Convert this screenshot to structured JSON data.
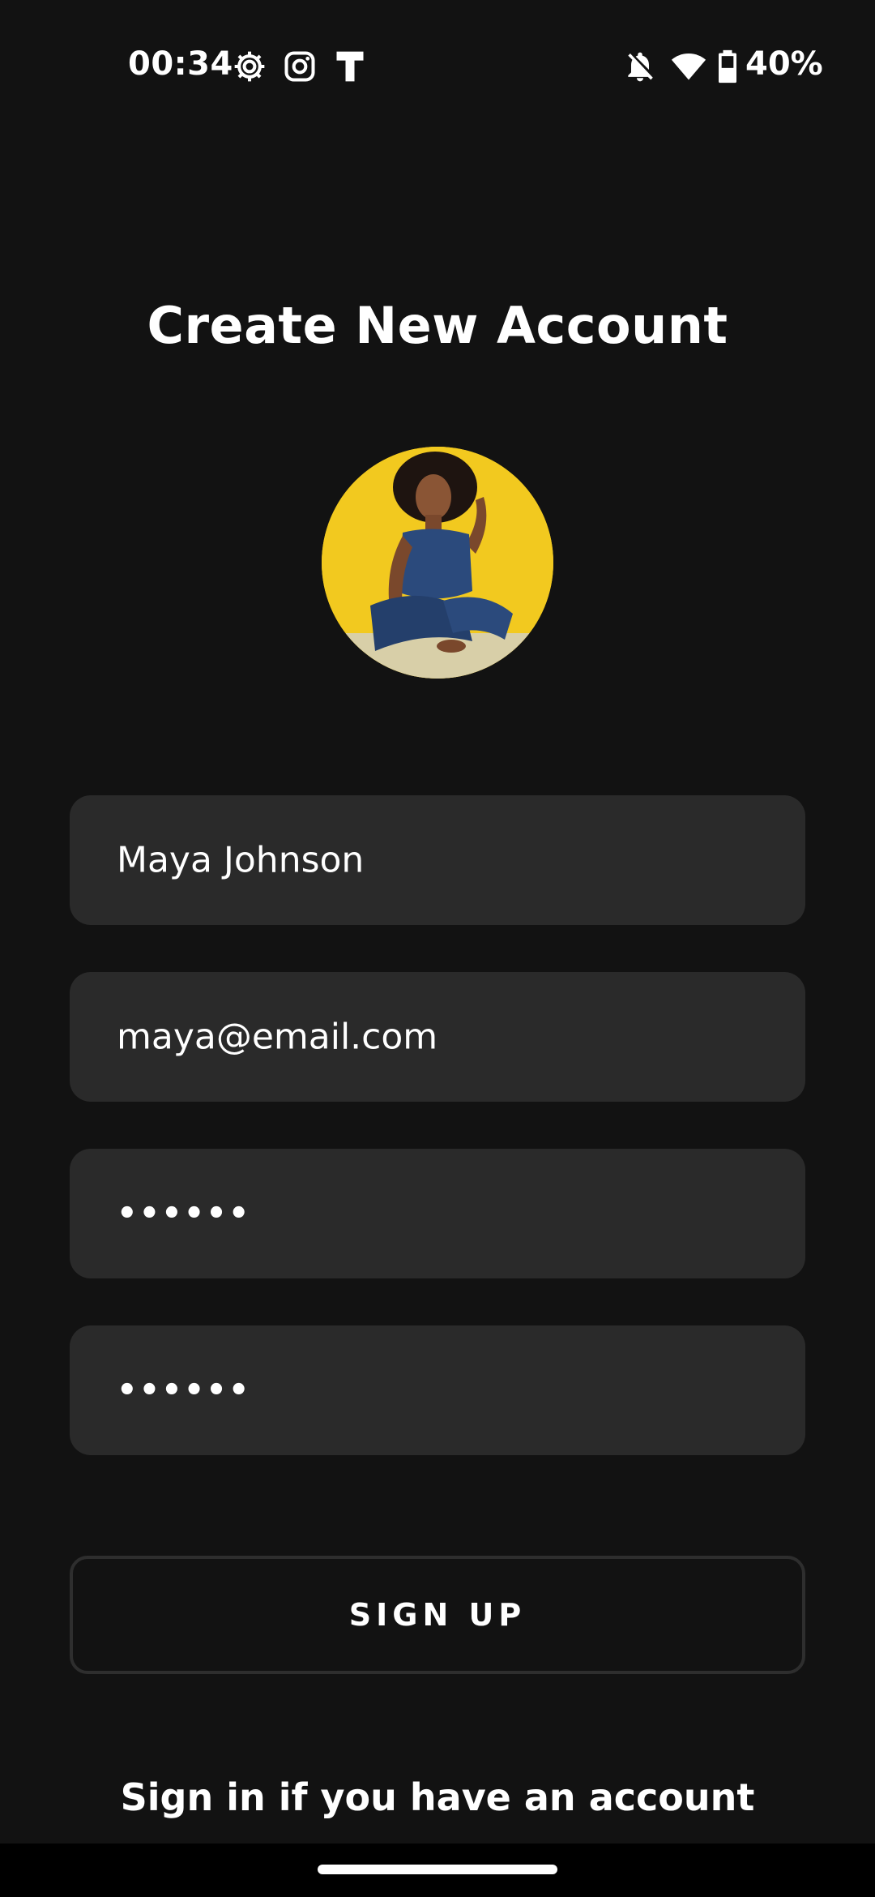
{
  "status_bar": {
    "time": "00:34",
    "battery_percent": "40%",
    "icons": [
      "settings-gear-icon",
      "instagram-icon",
      "t-app-icon",
      "bell-off-icon",
      "wifi-icon",
      "battery-icon"
    ]
  },
  "page": {
    "title": "Create New Account"
  },
  "avatar": {
    "icon": "profile-photo",
    "background_color": "#f2c91f"
  },
  "form": {
    "name_value": "Maya Johnson",
    "email_value": "maya@email.com",
    "password_value": "••••••",
    "confirm_password_value": "••••••"
  },
  "actions": {
    "signup_label": "SIGN UP",
    "signin_label": "Sign in if you have an account"
  },
  "colors": {
    "background": "#121212",
    "field_background": "#2a2a2a",
    "text": "#ffffff",
    "button_border": "#2e2e2e"
  }
}
